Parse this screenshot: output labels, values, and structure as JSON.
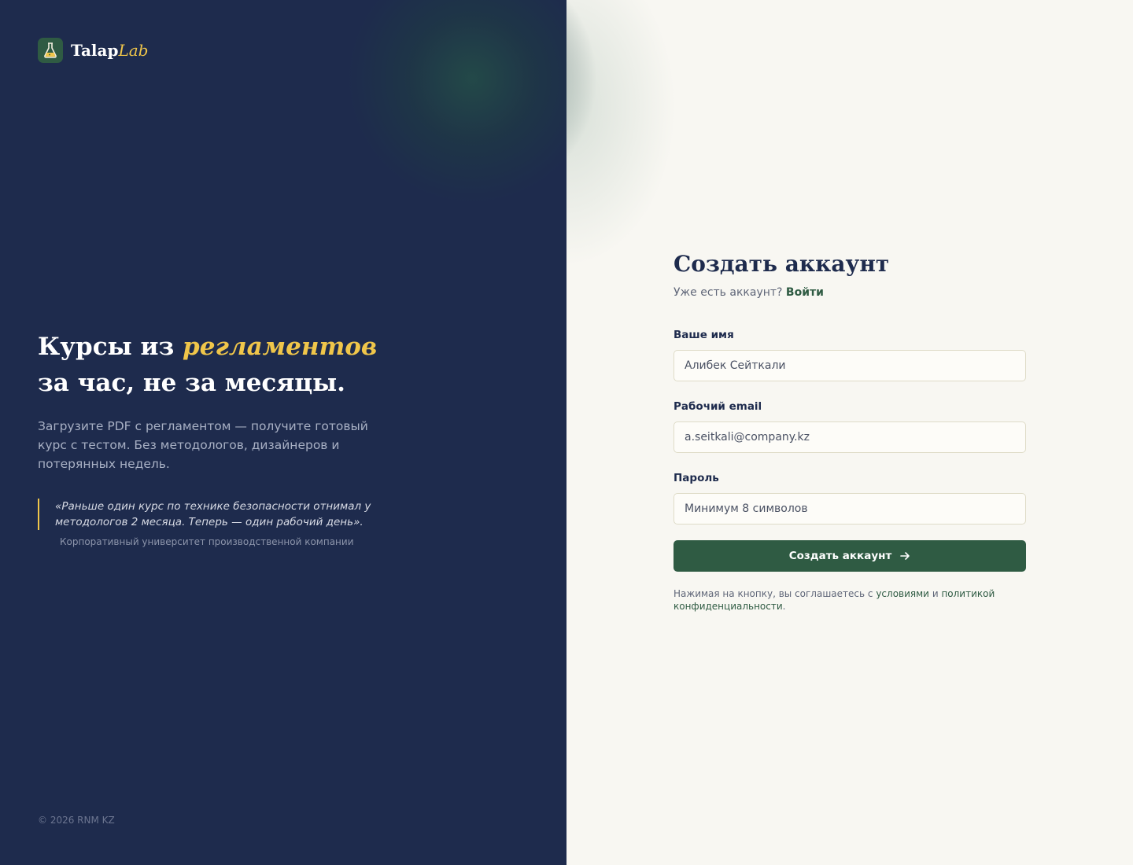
{
  "brand": {
    "name_part1": "Talap",
    "name_part2": "Lab",
    "icon": "flask-icon"
  },
  "hero": {
    "title_part1": "Курсы из ",
    "title_accent": "регламентов",
    "title_part2": "за час, не за месяцы.",
    "subtitle": "Загрузите PDF с регламентом — получите готовый курс с тестом. Без методологов, дизайнеров и потерянных недель."
  },
  "quote": {
    "text": "«Раньше один курс по технике безопасности отнимал у методологов 2 месяца. Теперь — один рабочий день».",
    "author": "Корпоративный университет производственной компании"
  },
  "footer": {
    "copyright": "© 2026 RNM KZ"
  },
  "form": {
    "title": "Создать аккаунт",
    "have_account": "Уже есть аккаунт?",
    "login_link": "Войти",
    "name_label": "Ваше имя",
    "name_placeholder": "Алибек Сейткали",
    "email_label": "Рабочий email",
    "email_placeholder": "a.seitkali@company.kz",
    "password_label": "Пароль",
    "password_placeholder": "Минимум 8 символов",
    "submit_label": "Создать аккаунт",
    "submit_icon": "arrow-right-icon",
    "terms_prefix": "Нажимая на кнопку, вы соглашаетесь с",
    "terms_link": "условиями",
    "terms_and": "и",
    "privacy_link": "политикой конфиденциальности",
    "terms_suffix": "."
  },
  "colors": {
    "left_bg": "#1e2b4d",
    "right_bg": "#f8f7f2",
    "accent_yellow": "#f0c64a",
    "brand_green": "#2f5b43"
  }
}
